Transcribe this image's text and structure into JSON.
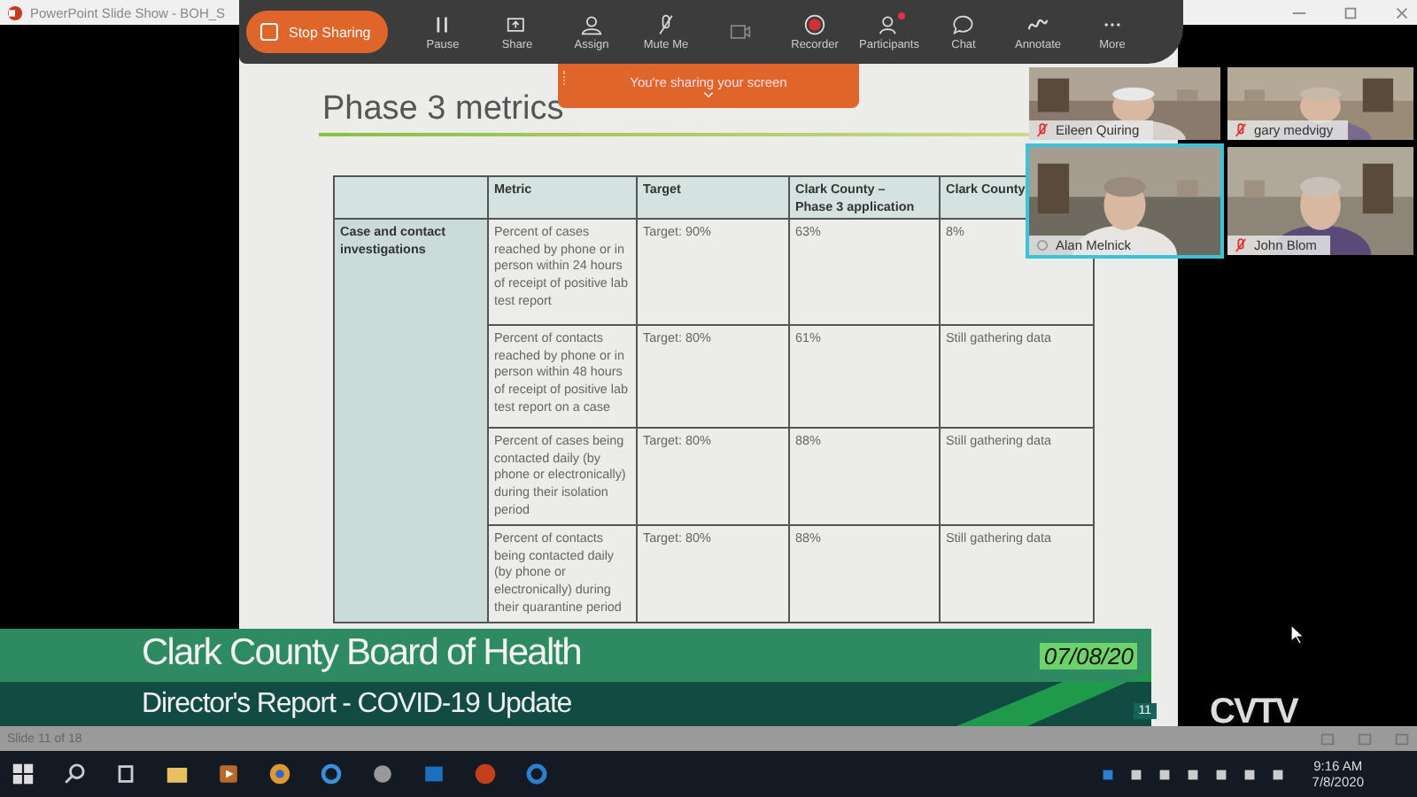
{
  "title_bar": {
    "title": "PowerPoint Slide Show  -  BOH_S"
  },
  "zoom_toolbar": {
    "stop_sharing": "Stop Sharing",
    "tools": [
      {
        "kind": "pause",
        "label": "Pause",
        "alert": false
      },
      {
        "kind": "share",
        "label": "Share",
        "alert": false
      },
      {
        "kind": "assign",
        "label": "Assign",
        "alert": false
      },
      {
        "kind": "mute",
        "label": "Mute Me",
        "alert": false
      },
      {
        "kind": "video",
        "alert": false
      },
      {
        "kind": "recorder",
        "label": "Recorder",
        "alert": false
      },
      {
        "kind": "participants",
        "label": "Participants",
        "alert": true
      },
      {
        "kind": "chat",
        "label": "Chat",
        "alert": false
      },
      {
        "kind": "annotate",
        "label": "Annotate",
        "alert": false
      },
      {
        "kind": "more",
        "label": "More",
        "alert": false
      }
    ]
  },
  "sharing_banner": {
    "text": "You're sharing your screen"
  },
  "slide": {
    "title": "Phase 3 metrics",
    "slide_number": "11",
    "table": {
      "columns": [
        "Metric",
        "Target",
        "Clark County –\nPhase 3 application",
        "Clark County"
      ],
      "group": "Case and contact investigations",
      "rows": [
        {
          "metric": "Percent of cases reached by phone or in person within 24 hours of receipt of positive lab test report",
          "target": "Target: 90%",
          "phase3": "63%",
          "column_5": "8%"
        },
        {
          "metric": "Percent of contacts reached by phone or in person within 48 hours of receipt of positive lab test report on a case",
          "target": "Target: 80%",
          "phase3": "61%",
          "column_5": "Still gathering data"
        },
        {
          "metric": "Percent of cases being contacted daily (by phone or electronically) during their isolation period",
          "target": "Target: 80%",
          "phase3": "88%",
          "column_5": "Still gathering data"
        },
        {
          "metric": "Percent of contacts being contacted daily (by phone or electronically) during their quarantine period",
          "target": "Target: 80%",
          "phase3": "88%",
          "column_5": "Still gathering data"
        }
      ]
    }
  },
  "participants": [
    {
      "name": "Eileen Quiring",
      "muted": true,
      "speaking": false
    },
    {
      "name": "gary medvigy",
      "muted": true,
      "speaking": false
    },
    {
      "name": "Alan Melnick",
      "muted": false,
      "speaking": true
    },
    {
      "name": "John Blom",
      "muted": true,
      "speaking": false
    }
  ],
  "broadcast": {
    "title": "Clark County Board of Health",
    "subtitle": "Director's Report - COVID-19 Update",
    "date": "07/08/20",
    "logo": "CVTV"
  },
  "status_bar": {
    "slide_info": "Slide 11 of 18"
  },
  "taskbar": {
    "time": "9:16 AM",
    "date": "7/8/2020"
  }
}
